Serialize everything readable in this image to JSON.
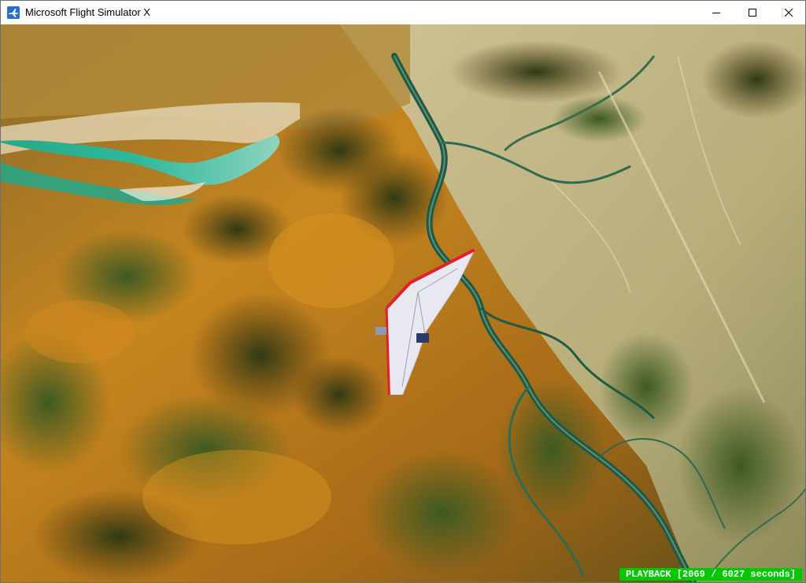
{
  "window": {
    "title": "Microsoft Flight Simulator X",
    "app_icon": "plane-icon",
    "controls": {
      "minimize_icon": "minimize-icon",
      "maximize_icon": "maximize-icon",
      "close_icon": "close-icon"
    }
  },
  "scene": {
    "subject_icon": "hang-glider-icon",
    "colors": {
      "terrain_ochre": "#c7861f",
      "terrain_dark": "#4a3a12",
      "vegetation": "#3d5a22",
      "river": "#1f5a46",
      "lagoon": "#2fb99a",
      "floodplain": "#b8ae7a",
      "glider_sail": "#e8e8f0",
      "glider_edge": "#e0202a"
    }
  },
  "status": {
    "playback_text": "PLAYBACK [2069 / 6027 seconds]",
    "playback_elapsed": 2069,
    "playback_total": 6027,
    "badge_color": "#00c800"
  }
}
